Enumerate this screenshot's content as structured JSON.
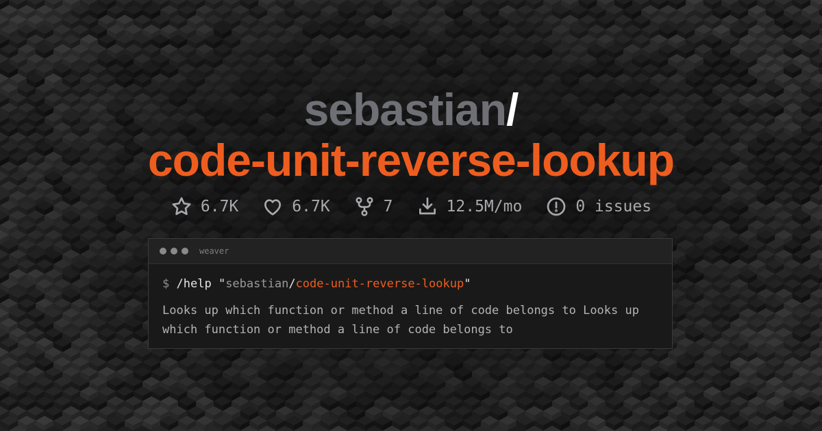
{
  "header": {
    "owner": "sebastian",
    "slash": "/",
    "repo": "code-unit-reverse-lookup"
  },
  "stats": [
    {
      "icon": "star-icon",
      "value": "6.7K"
    },
    {
      "icon": "heart-icon",
      "value": "6.7K"
    },
    {
      "icon": "fork-icon",
      "value": "7"
    },
    {
      "icon": "download-icon",
      "value": "12.5M/mo"
    },
    {
      "icon": "issue-icon",
      "value": "0 issues"
    }
  ],
  "terminal": {
    "title": "weaver",
    "prompt": "$",
    "command": "/help",
    "quote_open": "\"",
    "arg_owner": "sebastian",
    "arg_slash": "/",
    "arg_repo": "code-unit-reverse-lookup",
    "quote_close": "\"",
    "description": "Looks up which function or method a line of code belongs to Looks up which function or method a line of code belongs to"
  },
  "colors": {
    "accent": "#ee5d1f",
    "owner": "#6f6f76",
    "background": "#121212"
  }
}
